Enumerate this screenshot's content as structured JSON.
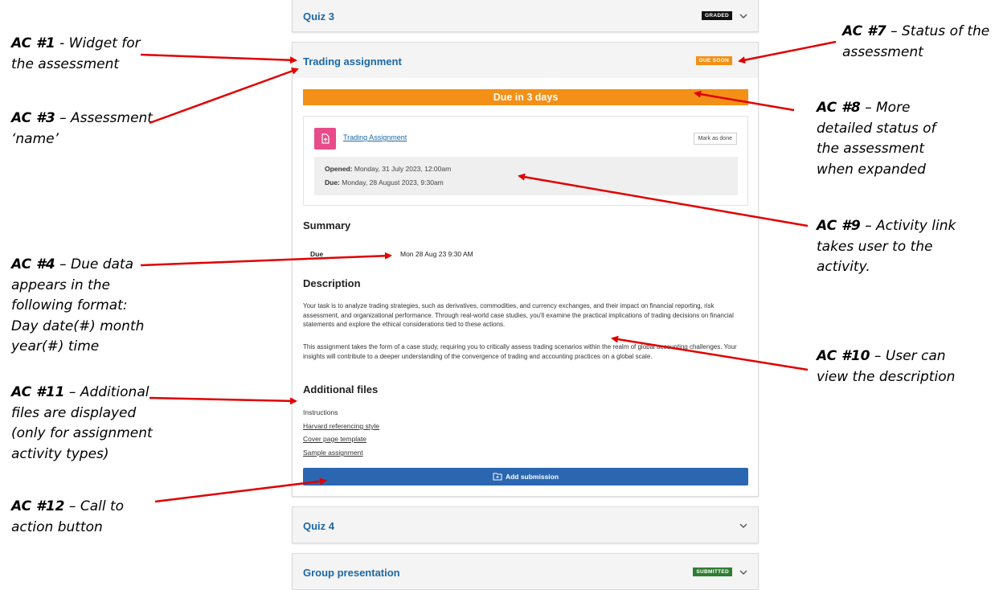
{
  "cards": {
    "quiz3": {
      "title": "Quiz 3",
      "badge": "GRADED",
      "badge_color": "#111111"
    },
    "trading": {
      "title": "Trading assignment",
      "badge": "DUE SOON",
      "badge_color": "#f39017",
      "due_banner": "Due in 3 days",
      "activity_link": "Trading Assignment",
      "mark_done": "Mark as done",
      "opened_label": "Opened:",
      "opened_value": "Monday, 31 July 2023, 12:00am",
      "due_label": "Due:",
      "due_value": "Monday, 28 August 2023, 9:30am",
      "summary_heading": "Summary",
      "summary_due_label": "Due",
      "summary_due_value": "Mon 28 Aug 23 9:30 AM",
      "description_heading": "Description",
      "description_p1": "Your task is to analyze trading strategies, such as derivatives, commodities, and currency exchanges, and their impact on financial reporting, risk assessment, and organizational performance. Through real-world case studies, you'll examine the practical implications of trading decisions on financial statements and explore the ethical considerations tied to these actions.",
      "description_p2": "This assignment takes the form of a case study, requiring you to critically assess trading scenarios within the realm of global accounting challenges. Your insights will contribute to a deeper understanding of the convergence of trading and accounting practices on a global scale.",
      "files_heading": "Additional files",
      "files": [
        "Instructions",
        "Harvard referencing style",
        "Cover page template",
        "Sample assignment"
      ],
      "submit_label": "Add submission"
    },
    "quiz4": {
      "title": "Quiz 4"
    },
    "group": {
      "title": "Group presentation",
      "badge": "SUBMITTED",
      "badge_color": "#2e7d32"
    }
  },
  "annotations": {
    "ac1": {
      "num": "AC #1",
      "text": " - Widget for the assessment"
    },
    "ac3": {
      "num": "AC #3",
      "text": " – Assessment ‘name’"
    },
    "ac4": {
      "num": "AC #4",
      "text": " – Due data appears in the following format: Day date(#) month year(#) time"
    },
    "ac7": {
      "num": "AC #7",
      "text": " – Status of the assessment"
    },
    "ac8": {
      "num": "AC #8",
      "text": " – More detailed status of the assessment when expanded"
    },
    "ac9": {
      "num": "AC #9",
      "text": " – Activity link takes user to the activity."
    },
    "ac10": {
      "num": "AC #10",
      "text": " – User can view the description"
    },
    "ac11": {
      "num": "AC #11",
      "text": " – Additional files are displayed (only for assignment activity types)"
    },
    "ac12": {
      "num": "AC #12",
      "text": " – Call to action button"
    }
  },
  "arrow_color": "#e00000"
}
